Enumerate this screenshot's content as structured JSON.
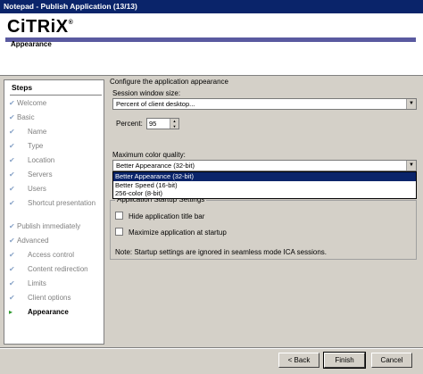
{
  "window": {
    "title": "Notepad - Publish Application (13/13)"
  },
  "header": {
    "logo": "CiTRiX",
    "logo_mark": "®",
    "subtitle": "Appearance",
    "bar_color": "#5a5aa0"
  },
  "steps": {
    "title": "Steps",
    "items": [
      {
        "label": "Welcome",
        "icon": "check-icon"
      },
      {
        "label": "Basic",
        "icon": "check-icon"
      },
      {
        "label": "Name",
        "icon": "check-icon"
      },
      {
        "label": "Type",
        "icon": "check-icon"
      },
      {
        "label": "Location",
        "icon": "check-icon"
      },
      {
        "label": "Servers",
        "icon": "check-icon"
      },
      {
        "label": "Users",
        "icon": "check-icon"
      },
      {
        "label": "Shortcut presentation",
        "icon": "check-icon"
      },
      {
        "label": "Publish immediately",
        "icon": "check-icon"
      },
      {
        "label": "Advanced",
        "icon": "check-icon"
      },
      {
        "label": "Access control",
        "icon": "check-icon"
      },
      {
        "label": "Content redirection",
        "icon": "check-icon"
      },
      {
        "label": "Limits",
        "icon": "check-icon"
      },
      {
        "label": "Client options",
        "icon": "check-icon"
      },
      {
        "label": "Appearance",
        "icon": "arrow-icon",
        "current": true
      }
    ]
  },
  "main": {
    "intro": "Configure the application appearance",
    "session_label": "Session window size:",
    "session_value": "Percent of client desktop...",
    "percent_label": "Percent:",
    "percent_value": "95",
    "color_label": "Maximum color quality:",
    "color_value": "Better Appearance (32-bit)",
    "color_options": [
      "Better Appearance (32-bit)",
      "Better Speed (16-bit)",
      "256-color (8-bit)"
    ],
    "startup_group": "Application Startup Settings",
    "hide_title": "Hide application title bar",
    "maximize": "Maximize application at startup",
    "note": "Note: Startup settings are ignored in seamless mode ICA sessions."
  },
  "buttons": {
    "back": "< Back",
    "finish": "Finish",
    "cancel": "Cancel"
  }
}
